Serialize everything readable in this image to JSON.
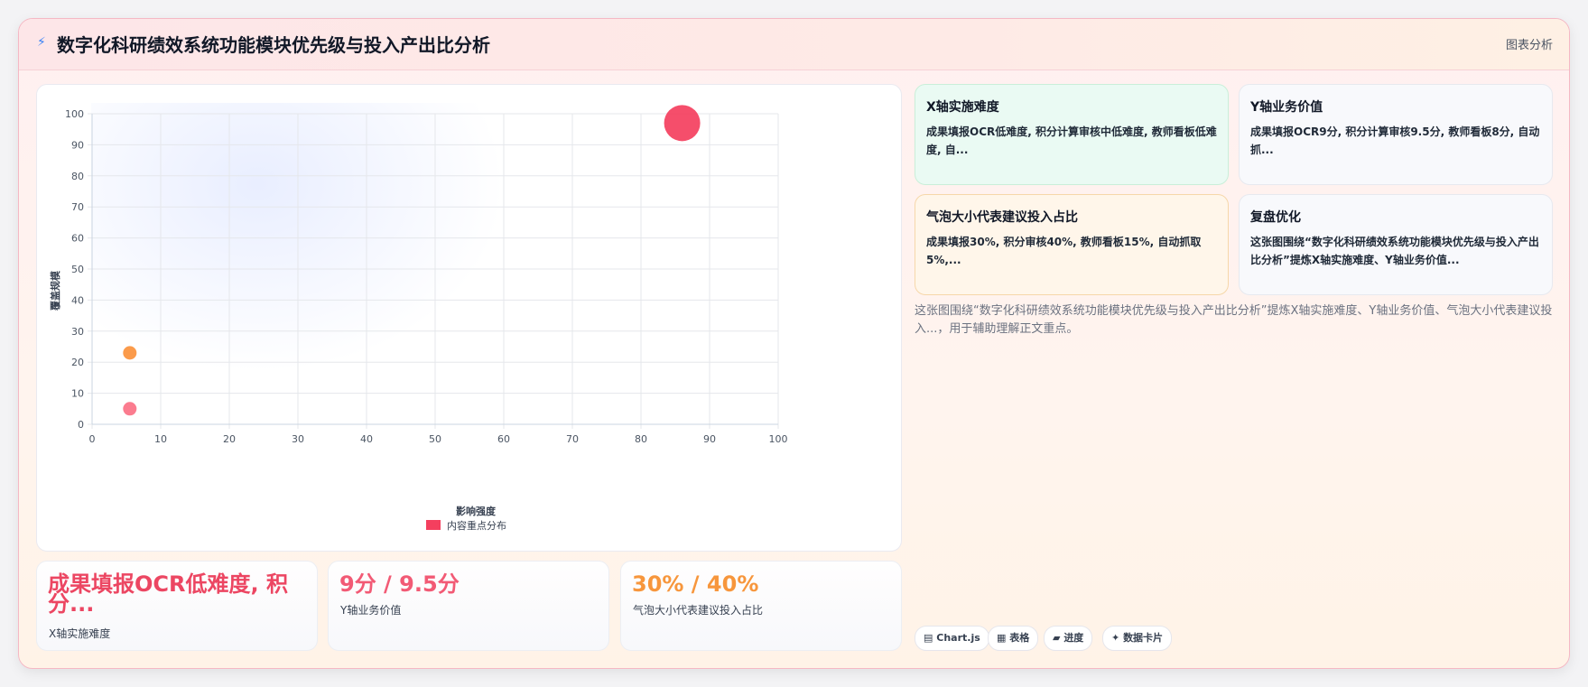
{
  "header": {
    "icon": "lightning-icon",
    "title": "数字化科研绩效系统功能模块优先级与投入产出比分析",
    "button_label": "图表分析"
  },
  "chart_data": {
    "type": "scatter",
    "xlabel": "影响强度",
    "ylabel": "覆盖规模",
    "xlim": [
      0,
      100
    ],
    "ylim": [
      0,
      100
    ],
    "x_ticks": [
      0,
      10,
      20,
      30,
      40,
      50,
      60,
      70,
      80,
      90,
      100
    ],
    "y_ticks": [
      0,
      10,
      20,
      30,
      40,
      50,
      60,
      70,
      80,
      90,
      100
    ],
    "grid": true,
    "legend_position": "bottom",
    "series": [
      {
        "name": "内容重点分布",
        "color": "#f43f5e",
        "points": [
          {
            "x": 86,
            "y": 97,
            "size": 40,
            "color": "#f43f5e"
          },
          {
            "x": 5.5,
            "y": 23,
            "size": 15,
            "color": "#fb923c"
          },
          {
            "x": 5.5,
            "y": 5,
            "size": 15,
            "color": "#fb7185"
          }
        ]
      }
    ]
  },
  "kpis": [
    {
      "value": "成果填报OCR低难度, 积分...",
      "label": "X轴实施难度",
      "color": "#ec4662"
    },
    {
      "value": "9分 / 9.5分",
      "label": "Y轴业务价值",
      "color": "#f25a75"
    },
    {
      "value": "30% / 40%",
      "label": "气泡大小代表建议投入占比",
      "color": "#f7963c"
    }
  ],
  "info_cards": [
    {
      "title": "X轴实施难度",
      "text": "成果填报OCR低难度, 积分计算审核中低难度, 教师看板低难度, 自..."
    },
    {
      "title": "Y轴业务价值",
      "text": "成果填报OCR9分, 积分计算审核9.5分, 教师看板8分, 自动抓..."
    },
    {
      "title": "气泡大小代表建议投入占比",
      "text": "成果填报30%, 积分审核40%, 教师看板15%, 自动抓取5%,..."
    },
    {
      "title": "复盘优化",
      "text": "这张图围绕“数字化科研绩效系统功能模块优先级与投入产出比分析”提炼X轴实施难度、Y轴业务价值..."
    }
  ],
  "summary": "这张图围绕“数字化科研绩效系统功能模块优先级与投入产出比分析”提炼X轴实施难度、Y轴业务价值、气泡大小代表建议投入...，用于辅助理解正文重点。",
  "tags": [
    {
      "icon": "chart-icon",
      "label": "Chart.js"
    },
    {
      "icon": "table-icon",
      "label": "表格"
    },
    {
      "icon": "progress-icon",
      "label": "进度"
    },
    {
      "icon": "sparkle-icon",
      "label": "数据卡片"
    }
  ]
}
